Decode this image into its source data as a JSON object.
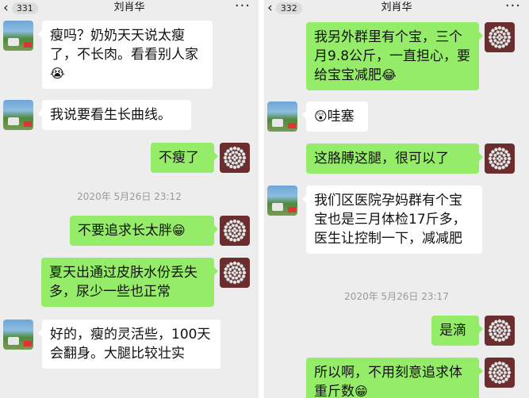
{
  "left": {
    "header": {
      "unread_count": "331",
      "title": "刘肖华",
      "more": "···",
      "back": "‹"
    },
    "messages": [
      {
        "text": "瘦吗？奶奶天天说太瘦了，不长肉。看看别人家",
        "emoji": "😭"
      },
      {
        "text": "我说要看生长曲线。"
      },
      {
        "text": "不瘦了"
      },
      {
        "text": "不要追求长太胖",
        "emoji": "😁"
      },
      {
        "text": "夏天出通过皮肤水份丢失多，尿少一些也正常"
      },
      {
        "text": "好的，瘦的灵活些，100天会翻身。大腿比较壮实"
      }
    ],
    "timestamp": "2020年 5月26日 23:12"
  },
  "right": {
    "header": {
      "unread_count": "332",
      "title": "刘肖华",
      "more": "···",
      "back": "‹"
    },
    "messages": [
      {
        "text": "我另外群里有个宝，三个月9.8公斤，一直担心，要给宝宝减肥",
        "emoji": "😂"
      },
      {
        "text": "哇塞",
        "emoji": "😲"
      },
      {
        "text": "这胳膊这腿，很可以了"
      },
      {
        "text": "我们区医院孕妈群有个宝宝也是三月体检17斤多，医生让控制一下，减减肥"
      },
      {
        "text": "是滴"
      },
      {
        "text": "所以啊，不用刻意追求体重斤数",
        "emoji": "😁"
      }
    ],
    "timestamp": "2020年 5月26日 23:17"
  }
}
